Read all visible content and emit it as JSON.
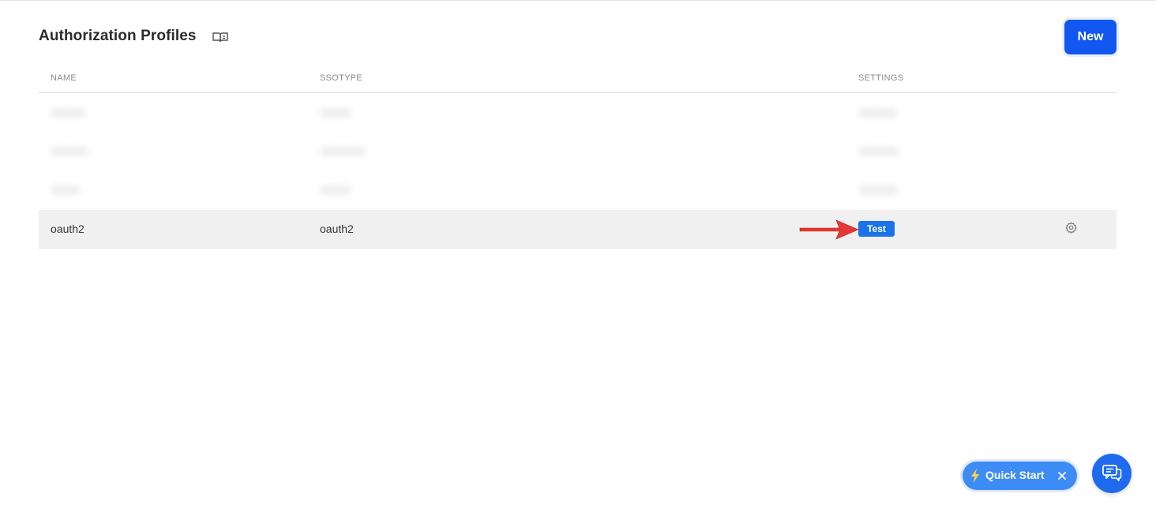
{
  "header": {
    "title": "Authorization Profiles",
    "new_label": "New"
  },
  "table": {
    "columns": [
      "NAME",
      "SSOTYPE",
      "SETTINGS"
    ],
    "highlighted_row": {
      "name": "oauth2",
      "ssotype": "oauth2",
      "test_label": "Test"
    }
  },
  "quick_start": {
    "label": "Quick Start"
  },
  "colors": {
    "primary": "#1258f0",
    "badge": "#1a73e8",
    "arrow": "#e53935",
    "row_highlight": "#f0f0f0"
  },
  "icons": [
    "book-icon",
    "gear-icon",
    "arrow-icon",
    "bolt-icon",
    "close-icon",
    "chat-icon"
  ]
}
